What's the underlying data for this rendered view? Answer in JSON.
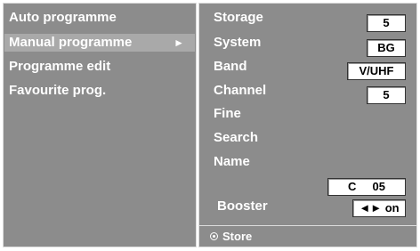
{
  "menu": {
    "items": [
      {
        "label": "Auto programme"
      },
      {
        "label": "Manual programme",
        "arrow": "►"
      },
      {
        "label": "Programme edit"
      },
      {
        "label": "Favourite prog."
      }
    ]
  },
  "settings": {
    "storage": {
      "label": "Storage",
      "value": "5"
    },
    "system": {
      "label": "System",
      "value": "BG"
    },
    "band": {
      "label": "Band",
      "value": "V/UHF"
    },
    "channel": {
      "label": "Channel",
      "value": "5"
    },
    "fine": {
      "label": "Fine"
    },
    "search": {
      "label": "Search"
    },
    "name": {
      "label": "Name",
      "value": "C     05"
    },
    "booster": {
      "label": "Booster",
      "value": "◄► on"
    }
  },
  "footer": {
    "store_label": "Store",
    "store_icon": "radio-button-icon"
  },
  "colors": {
    "panel": "#8c8c8c",
    "selected": "#a9a9a9",
    "text": "#ffffff"
  }
}
